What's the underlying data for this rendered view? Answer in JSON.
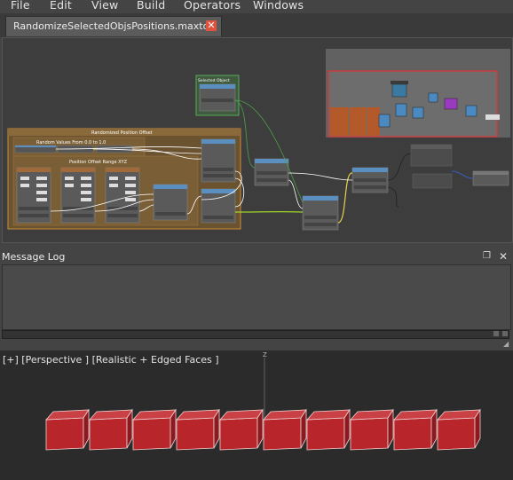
{
  "menu": {
    "file": "File",
    "edit": "Edit",
    "view": "View",
    "build": "Build",
    "operators": "Operators",
    "windows": "Windows"
  },
  "tab": {
    "label": "RandomizeSelectedObjsPositions.maxtool",
    "close": "✕"
  },
  "graph": {
    "selected_object_title": "Selected Object",
    "group_title": "Randomized Position Offset",
    "random_values_label": "Random Values From 0.0 to 1.0",
    "offset_range_label": "Position Offset Range XYZ"
  },
  "message_log": {
    "title": "Message Log",
    "pin_icon": "restore-icon",
    "close_icon": "close-icon"
  },
  "viewport": {
    "label": "[+] [Perspective ] [Realistic + Edged Faces ]",
    "axis_label": "Z",
    "cube_color": "#b8262c",
    "cube_count": 10
  },
  "colors": {
    "group_orange": "#c98c3a",
    "node_header_blue": "#5b8fbf",
    "highlight_red": "#d23a3a",
    "wire_green": "#9fd62a",
    "wire_yellow": "#e8d44a"
  }
}
